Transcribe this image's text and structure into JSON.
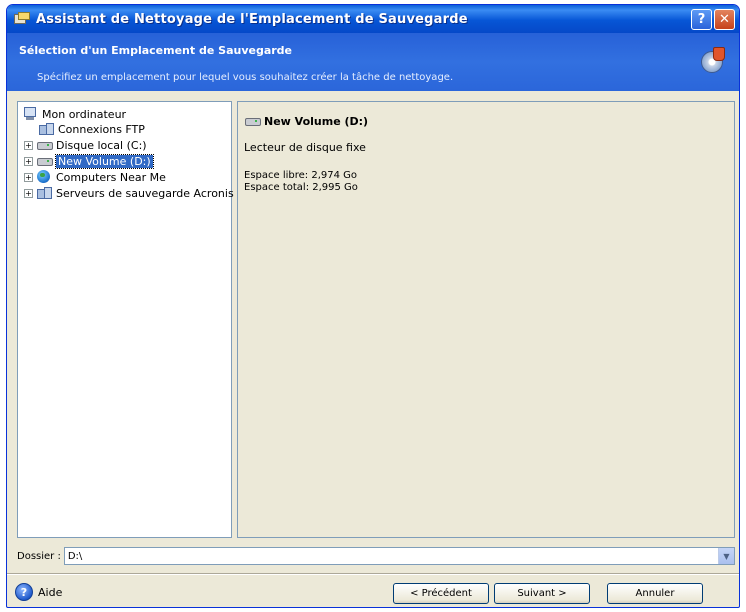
{
  "window": {
    "title": "Assistant de Nettoyage de l'Emplacement de Sauvegarde",
    "help_button": "?",
    "close_button": "✕"
  },
  "header": {
    "title": "Sélection d'un Emplacement de Sauvegarde",
    "subtitle": "Spécifiez un emplacement pour lequel vous souhaitez créer la tâche de nettoyage."
  },
  "tree": {
    "items": [
      {
        "label": "Mon ordinateur",
        "icon": "computer-icon",
        "expander": ""
      },
      {
        "label": "Connexions FTP",
        "icon": "network-icon",
        "expander": ""
      },
      {
        "label": "Disque local (C:)",
        "icon": "drive-icon",
        "expander": "+"
      },
      {
        "label": "New Volume (D:)",
        "icon": "drive-icon",
        "expander": "+",
        "selected": true
      },
      {
        "label": "Computers Near Me",
        "icon": "globe-icon",
        "expander": "+"
      },
      {
        "label": "Serveurs de sauvegarde Acronis",
        "icon": "network-icon",
        "expander": "+"
      }
    ]
  },
  "detail": {
    "title": "New Volume (D:)",
    "type": "Lecteur de disque fixe",
    "free_space": "Espace libre: 2,974 Go",
    "total_space": "Espace total: 2,995 Go"
  },
  "folder": {
    "label": "Dossier :",
    "value": "D:\\"
  },
  "footer": {
    "help_label": "Aide",
    "prev_button": "< Précédent",
    "next_button": "Suivant >",
    "cancel_button": "Annuler"
  },
  "colors": {
    "titlebar": "#0756d6",
    "header": "#3270e0",
    "selection": "#316ac5",
    "dialog_bg": "#ece9d8"
  }
}
